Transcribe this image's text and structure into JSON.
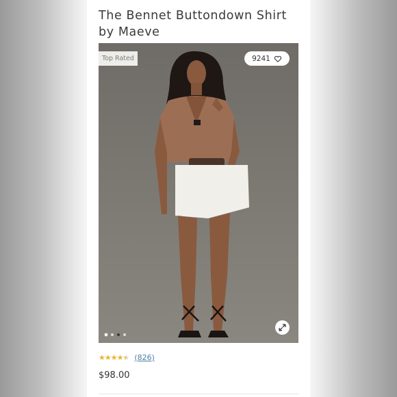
{
  "product": {
    "title": "The Bennet Buttondown Shirt by Maeve",
    "badge": "Top Rated",
    "like_count": "9241",
    "rating": 4.5,
    "review_count": "(826)",
    "price": "$98.00"
  },
  "gallery": {
    "slide_count": 4,
    "active_slide": 1
  },
  "icons": {
    "like": "heart-icon",
    "expand": "expand-icon"
  },
  "colors": {
    "star": "#e8b531",
    "link": "#4d7fa3",
    "photo_bg": "#77736d"
  }
}
